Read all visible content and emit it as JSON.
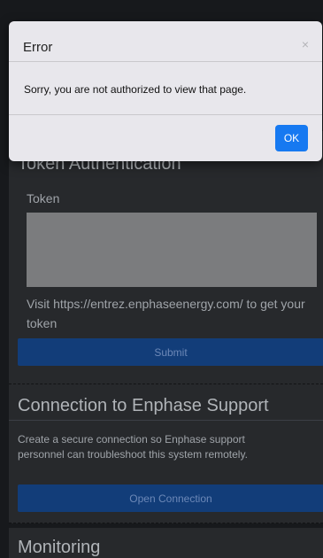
{
  "token_section": {
    "title": "Token Authentication",
    "token_label": "Token",
    "visit_text": "Visit https://entrez.enphaseenergy.com/ to get your token",
    "submit_label": "Submit"
  },
  "connection_section": {
    "title": "Connection to Enphase Support",
    "description": "Create a secure connection so Enphase support personnel can troubleshoot this system remotely.",
    "button_label": "Open Connection"
  },
  "monitoring_section": {
    "title": "Monitoring"
  },
  "modal": {
    "title": "Error",
    "close_icon": "×",
    "message": "Sorry, you are not authorized to view that page.",
    "ok_label": "OK"
  },
  "colors": {
    "background": "#1b1d20",
    "panel": "#2d2f33",
    "primary_button": "#15468a",
    "ok_button": "#1679f1"
  }
}
